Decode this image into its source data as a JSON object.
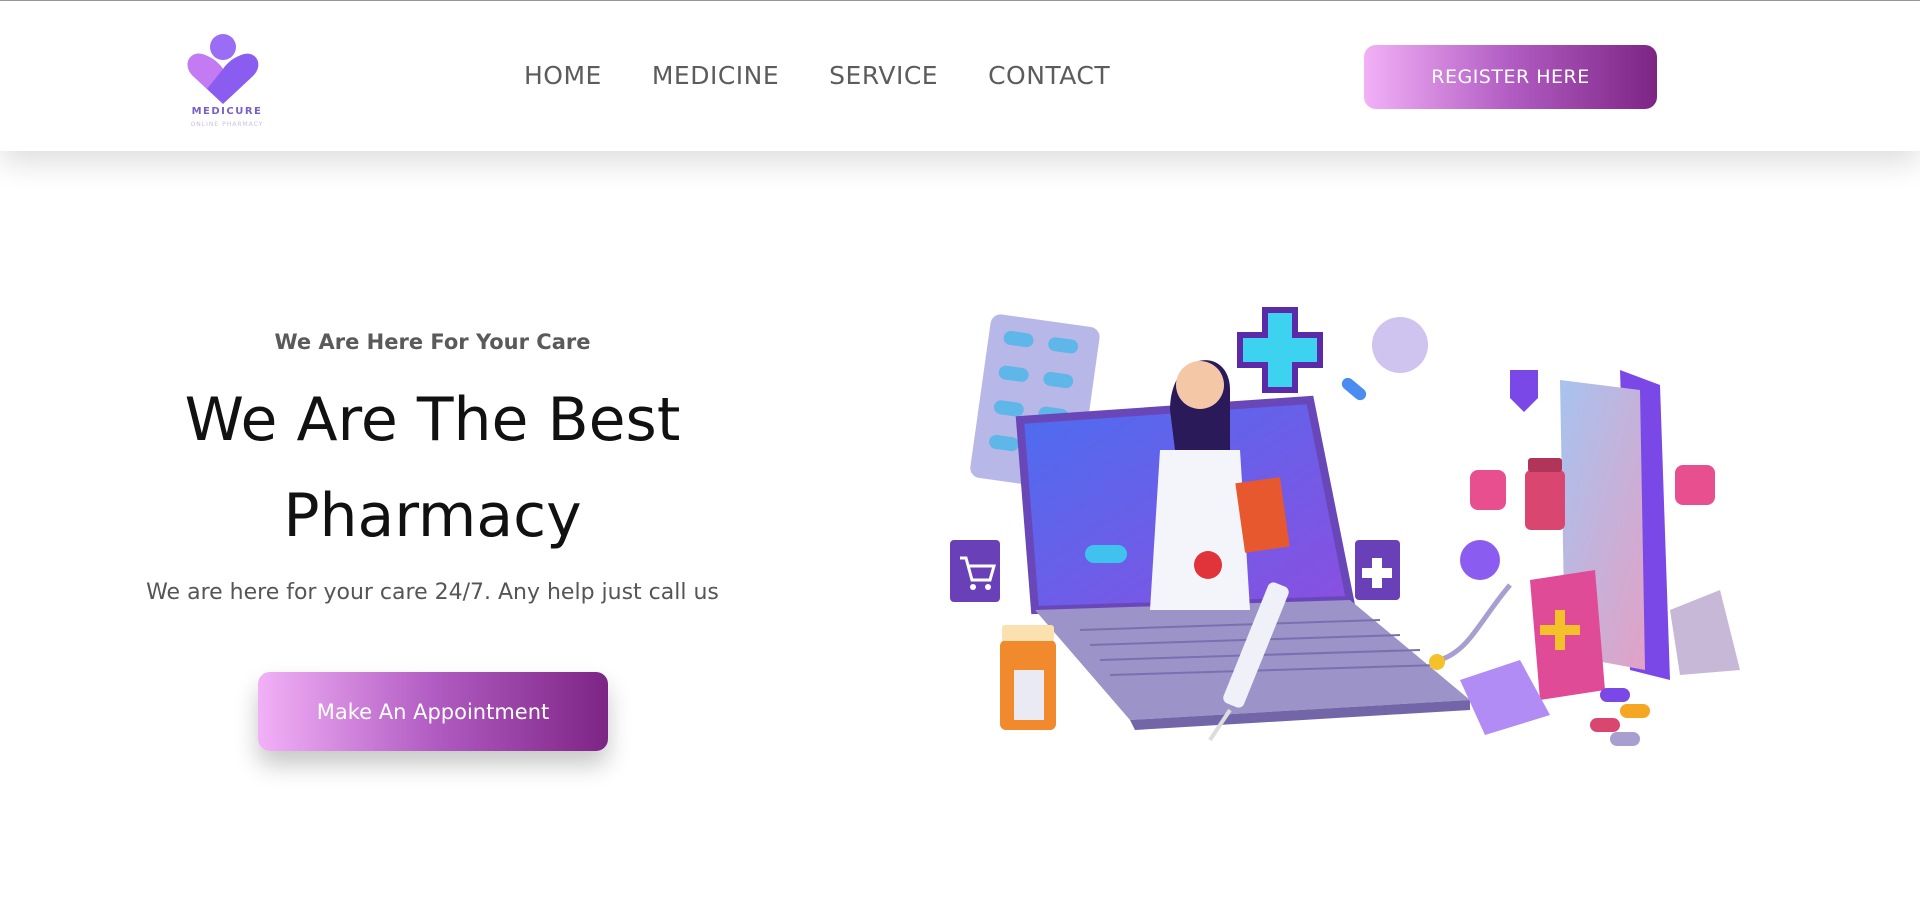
{
  "brand": {
    "name": "MEDICURE",
    "tagline_small": "ONLINE PHARMACY",
    "accent_colors": [
      "#f2b1f7",
      "#b15cc2",
      "#7d2585"
    ],
    "logo_colors": [
      "#8a5cf0",
      "#c084fc"
    ]
  },
  "nav": {
    "items": [
      "HOME",
      "MEDICINE",
      "SERVICE",
      "CONTACT"
    ]
  },
  "header": {
    "register_label": "REGISTER HERE"
  },
  "hero": {
    "tagline": "We Are Here For Your Care",
    "title_line1": "We Are The Best",
    "title_line2": "Pharmacy",
    "description": "We are here for your care 24/7. Any help just call us",
    "cta_label": "Make An Appointment"
  },
  "illustration": {
    "subject": "online-pharmacy-doctor-laptop",
    "icons": [
      "pill-blister-icon",
      "medical-cross-icon",
      "shopping-cart-icon",
      "syringe-icon",
      "medicine-bottle-icon",
      "smartphone-icon",
      "shopping-bag-icon",
      "stethoscope-icon",
      "capsule-icon"
    ]
  }
}
